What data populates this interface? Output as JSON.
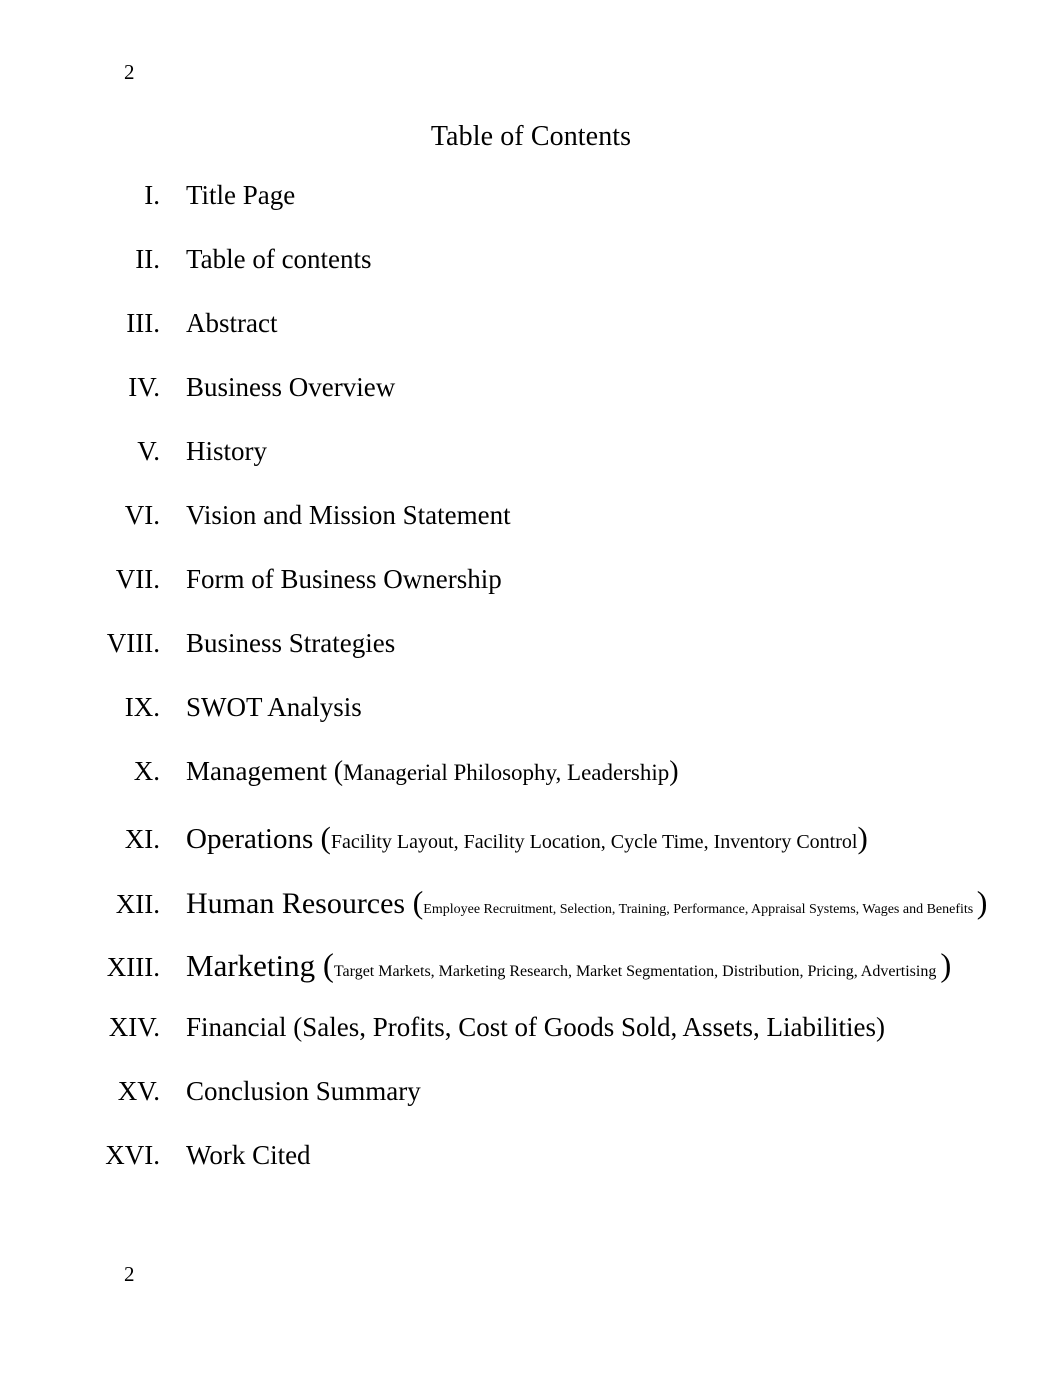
{
  "document": {
    "header_page_number": "2",
    "footer_page_number": "2",
    "title": "Table of Contents"
  },
  "toc": {
    "entries": [
      {
        "numeral": "I.",
        "label": "Title Page",
        "paren_open": "",
        "detail": "",
        "paren_close": "",
        "variant": "v-normal"
      },
      {
        "numeral": "II.",
        "label": "Table of contents",
        "paren_open": "",
        "detail": "",
        "paren_close": "",
        "variant": "v-normal"
      },
      {
        "numeral": "III.",
        "label": "Abstract",
        "paren_open": "",
        "detail": "",
        "paren_close": "",
        "variant": "v-normal"
      },
      {
        "numeral": "IV.",
        "label": "Business Overview",
        "paren_open": "",
        "detail": "",
        "paren_close": "",
        "variant": "v-normal"
      },
      {
        "numeral": "V.",
        "label": "History",
        "paren_open": "",
        "detail": "",
        "paren_close": "",
        "variant": "v-normal"
      },
      {
        "numeral": "VI.",
        "label": "Vision and Mission Statement",
        "paren_open": "",
        "detail": "",
        "paren_close": "",
        "variant": "v-normal"
      },
      {
        "numeral": "VII.",
        "label": "Form of Business Ownership",
        "paren_open": "",
        "detail": "",
        "paren_close": "",
        "variant": "v-normal"
      },
      {
        "numeral": "VIII.",
        "label": "Business Strategies",
        "paren_open": "",
        "detail": "",
        "paren_close": "",
        "variant": "v-normal"
      },
      {
        "numeral": "IX.",
        "label": "SWOT Analysis",
        "paren_open": "",
        "detail": "",
        "paren_close": "",
        "variant": "v-normal"
      },
      {
        "numeral": "X.",
        "label": "Management ",
        "paren_open": "(",
        "detail": "Managerial Philosophy, Leadership",
        "paren_close": ")",
        "variant": "v-mgmt"
      },
      {
        "numeral": "XI.",
        "label": "Operations ",
        "paren_open": "(",
        "detail": "Facility Layout, Facility Location, Cycle Time, Inventory Control",
        "paren_close": ")",
        "variant": "v-ops"
      },
      {
        "numeral": "XII.",
        "label": "Human Resources ",
        "paren_open": "(",
        "detail": "Employee Recruitment, Selection, Training, Performance, Appraisal Systems, Wages and Benefits ",
        "paren_close": ")",
        "variant": "v-hr"
      },
      {
        "numeral": "XIII.",
        "label": "Marketing ",
        "paren_open": "(",
        "detail": "Target Markets, Marketing Research, Market Segmentation, Distribution, Pricing, Advertising ",
        "paren_close": ")",
        "variant": "v-mkt"
      },
      {
        "numeral": "XIV.",
        "label": "Financial ",
        "paren_open": "(",
        "detail": "Sales, Profits, Cost of Goods Sold, Assets, Liabilities",
        "paren_close": ")",
        "variant": "v-normal"
      },
      {
        "numeral": "XV.",
        "label": "Conclusion Summary",
        "paren_open": "",
        "detail": "",
        "paren_close": "",
        "variant": "v-normal"
      },
      {
        "numeral": "XVI.",
        "label": "Work Cited",
        "paren_open": "",
        "detail": "",
        "paren_close": "",
        "variant": "v-normal"
      }
    ]
  }
}
